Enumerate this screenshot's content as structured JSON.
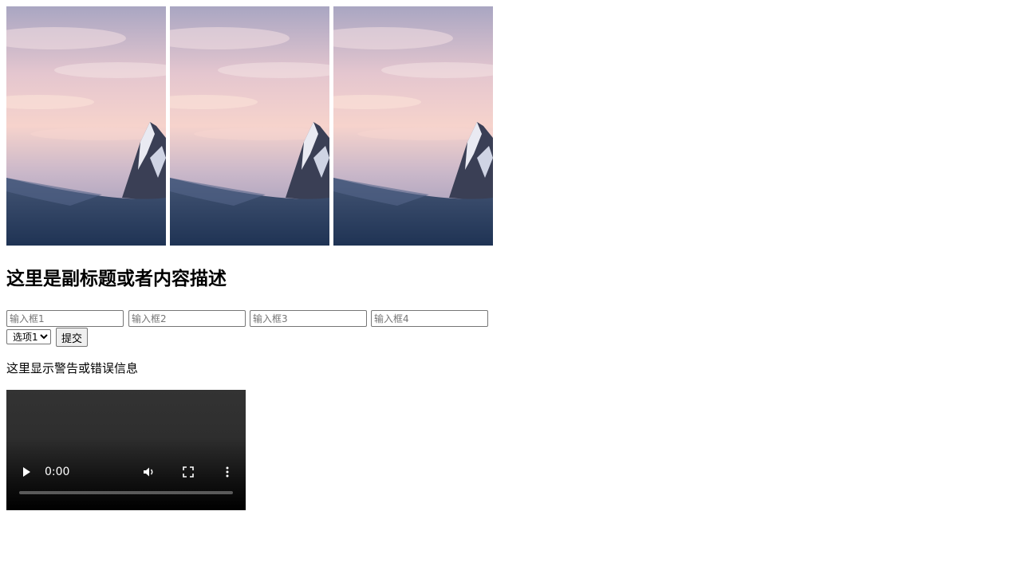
{
  "gallery": {
    "images": [
      {
        "alt": ""
      },
      {
        "alt": ""
      },
      {
        "alt": ""
      }
    ]
  },
  "subtitle": "这里是副标题或者内容描述",
  "form": {
    "inputs": [
      {
        "placeholder": "输入框1",
        "value": ""
      },
      {
        "placeholder": "输入框2",
        "value": ""
      },
      {
        "placeholder": "输入框3",
        "value": ""
      },
      {
        "placeholder": "输入框4",
        "value": ""
      }
    ],
    "select": {
      "selected": "选项1",
      "options": [
        "选项1"
      ]
    },
    "submit_label": "提交"
  },
  "warning": "这里显示警告或错误信息",
  "video": {
    "time": "0:00",
    "progress": 0,
    "icons": [
      "play-icon",
      "volume-icon",
      "fullscreen-icon",
      "more-options-icon"
    ]
  }
}
